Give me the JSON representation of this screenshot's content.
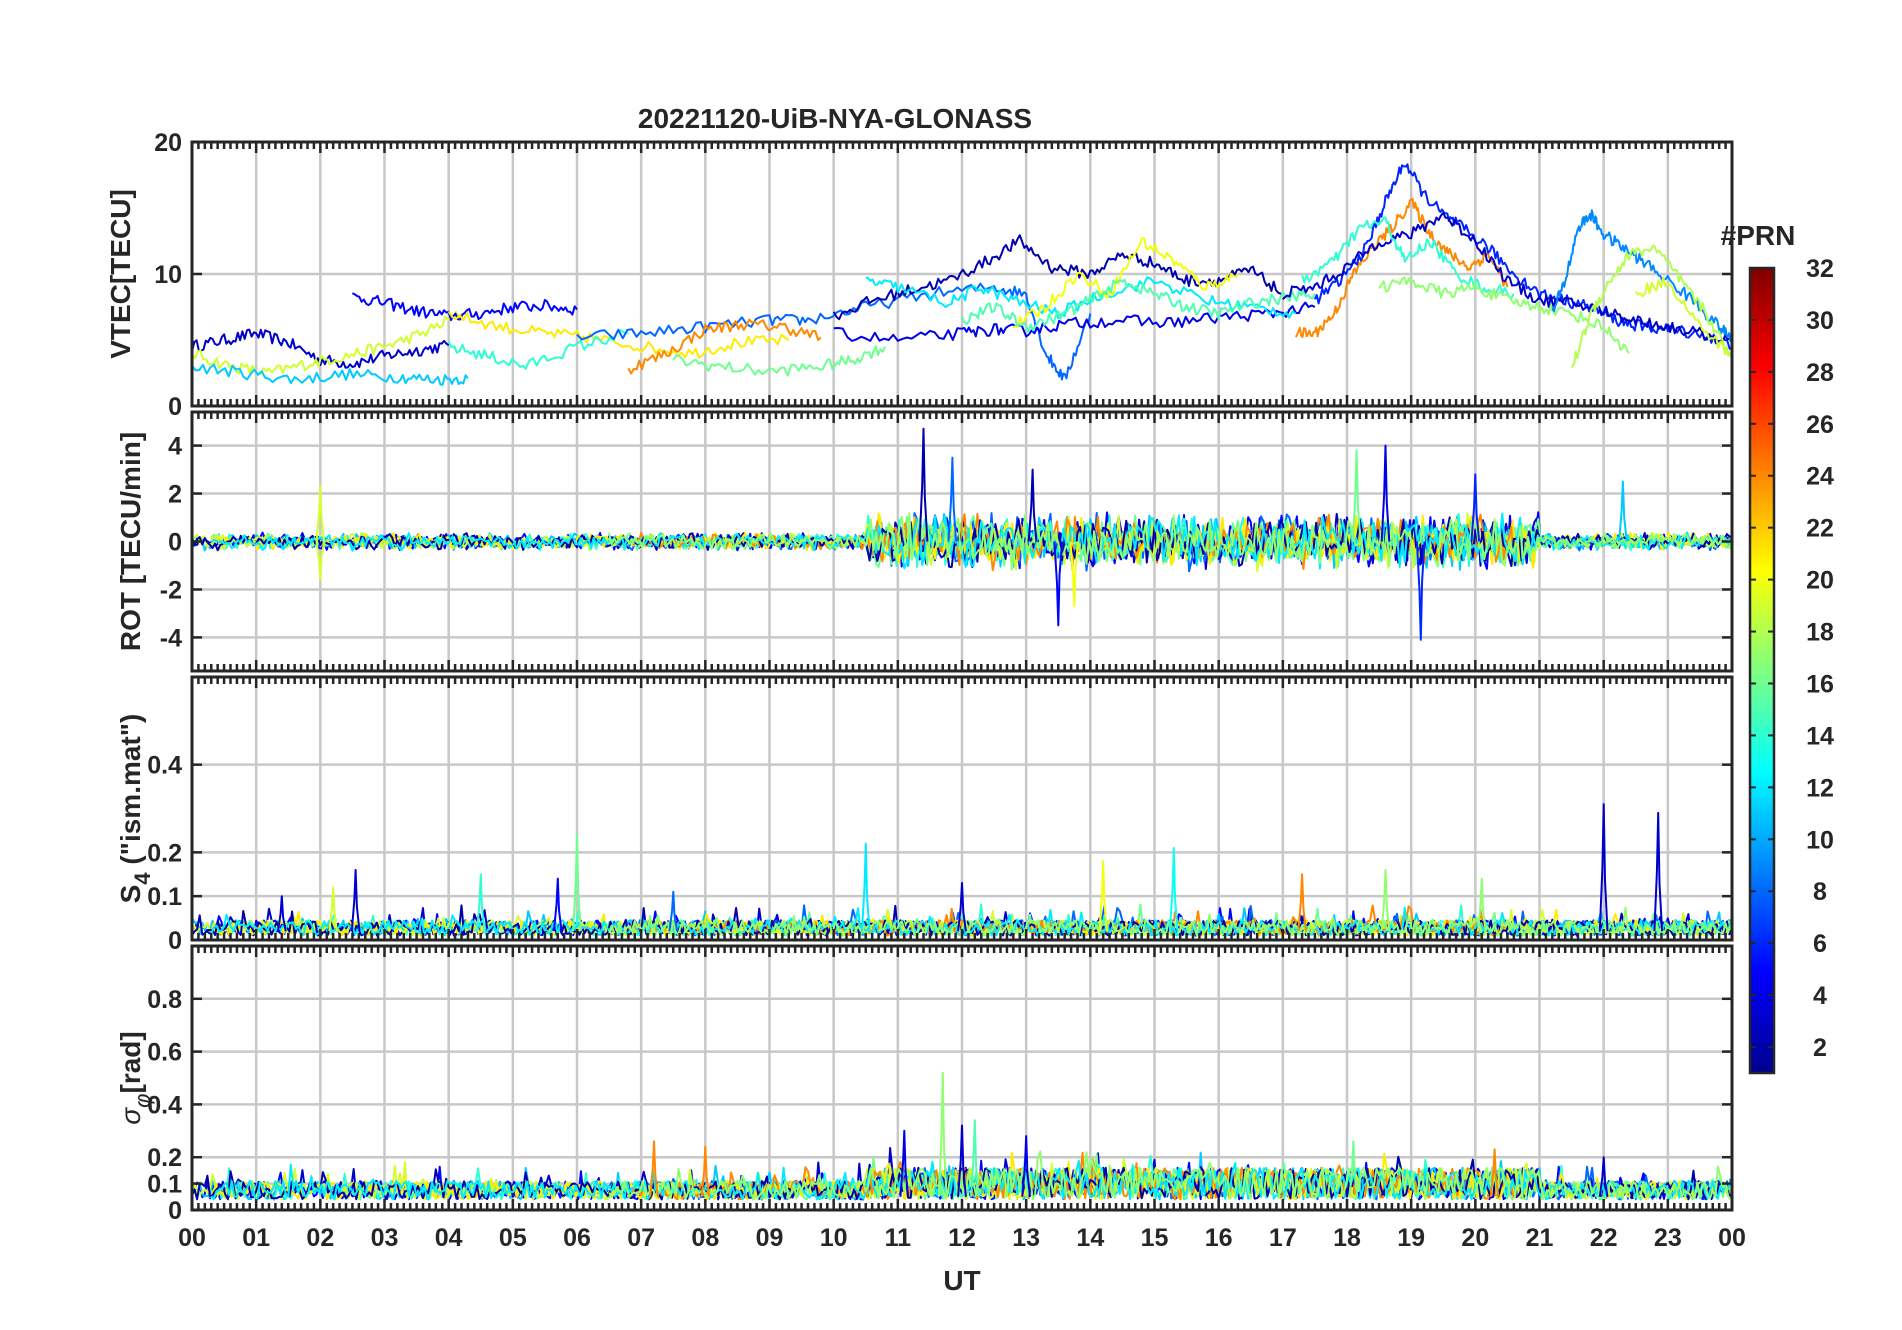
{
  "figure": {
    "title": "20221120-UiB-NYA-GLONASS"
  },
  "colorbar": {
    "label": "#PRN",
    "ticks": [
      "2",
      "4",
      "6",
      "8",
      "10",
      "12",
      "14",
      "16",
      "18",
      "20",
      "22",
      "24",
      "26",
      "28",
      "30",
      "32"
    ],
    "range": [
      1,
      32
    ],
    "colormap": "jet",
    "colors": [
      "#00008f",
      "#0000ff",
      "#0080ff",
      "#00ffff",
      "#80ff80",
      "#ffff00",
      "#ff8000",
      "#ff0000",
      "#800000"
    ]
  },
  "x_axis": {
    "label": "UT",
    "ticks": [
      "00",
      "01",
      "02",
      "03",
      "04",
      "05",
      "06",
      "07",
      "08",
      "09",
      "10",
      "11",
      "12",
      "13",
      "14",
      "15",
      "16",
      "17",
      "18",
      "19",
      "20",
      "21",
      "22",
      "23",
      "00"
    ],
    "range_hours": [
      0,
      24
    ]
  },
  "chart_data": [
    {
      "type": "line",
      "panel": "vtec",
      "ylabel": "VTEC[TECU]",
      "ylim": [
        0,
        20
      ],
      "yticks": [
        "0",
        "10",
        "20"
      ],
      "grid": true,
      "series": [
        {
          "prn": 3,
          "x": [
            0.0,
            0.5,
            1.0,
            1.5,
            2.0,
            2.5,
            3.0,
            3.5,
            4.0
          ],
          "y": [
            4.5,
            5.0,
            5.5,
            4.8,
            3.5,
            3.2,
            3.8,
            4.2,
            4.6
          ]
        },
        {
          "prn": 19,
          "x": [
            0.0,
            0.6,
            1.2,
            1.8,
            2.4,
            3.0,
            3.6,
            4.2
          ],
          "y": [
            4.0,
            3.0,
            2.5,
            3.2,
            3.8,
            4.5,
            5.5,
            7.0
          ]
        },
        {
          "prn": 11,
          "x": [
            0.0,
            0.8,
            1.6,
            2.4,
            3.2,
            3.8,
            4.3
          ],
          "y": [
            3.0,
            2.5,
            2.0,
            2.4,
            2.2,
            2.0,
            2.1
          ]
        },
        {
          "prn": 5,
          "x": [
            2.5,
            3.0,
            3.5,
            4.0,
            4.5,
            5.0,
            5.5,
            6.0
          ],
          "y": [
            8.3,
            7.8,
            7.2,
            6.8,
            7.0,
            7.5,
            7.6,
            7.3
          ]
        },
        {
          "prn": 21,
          "x": [
            4.0,
            4.8,
            5.5,
            6.2,
            7.0,
            7.8,
            8.5,
            9.3
          ],
          "y": [
            7.0,
            6.0,
            5.5,
            5.2,
            4.5,
            4.0,
            4.8,
            5.0
          ]
        },
        {
          "prn": 14,
          "x": [
            4.0,
            4.6,
            5.2,
            6.0,
            6.8
          ],
          "y": [
            4.5,
            3.8,
            3.0,
            4.5,
            5.5
          ]
        },
        {
          "prn": 8,
          "x": [
            6.0,
            7.0,
            8.0,
            9.0,
            9.6,
            10.5,
            11.5,
            12.5,
            13.0,
            13.3,
            13.6,
            14.0
          ],
          "y": [
            5.2,
            5.5,
            6.0,
            6.5,
            6.5,
            7.5,
            8.5,
            9.0,
            8.5,
            4.0,
            2.0,
            7.0
          ]
        },
        {
          "prn": 24,
          "x": [
            6.8,
            7.4,
            8.0,
            8.6,
            9.2,
            9.8
          ],
          "y": [
            2.8,
            4.0,
            5.8,
            6.2,
            6.0,
            5.2
          ]
        },
        {
          "prn": 16,
          "x": [
            7.5,
            8.2,
            9.0,
            9.8,
            10.3,
            10.8
          ],
          "y": [
            3.5,
            3.0,
            2.6,
            3.0,
            3.5,
            4.5
          ]
        },
        {
          "prn": 2,
          "x": [
            10.0,
            10.6,
            11.2,
            11.8,
            12.4,
            12.9,
            13.4,
            14.0,
            14.5,
            15.0,
            15.5,
            16.0,
            16.5,
            17.0
          ],
          "y": [
            6.8,
            8.0,
            8.8,
            9.5,
            11.0,
            12.5,
            10.5,
            10.0,
            11.5,
            10.8,
            9.5,
            9.5,
            10.3,
            8.5
          ]
        },
        {
          "prn": 4,
          "x": [
            10.0,
            11.0,
            12.0,
            12.5,
            13.0,
            13.6,
            14.4,
            15.2,
            16.0,
            16.8,
            17.5
          ],
          "y": [
            5.5,
            5.0,
            5.5,
            5.8,
            5.7,
            6.2,
            6.5,
            6.3,
            6.7,
            7.0,
            7.5
          ]
        },
        {
          "prn": 12,
          "x": [
            10.5,
            11.0,
            11.8,
            12.3,
            12.8,
            13.5,
            14.2,
            15.0,
            15.8,
            16.5,
            17.2
          ],
          "y": [
            9.5,
            9.0,
            7.8,
            9.0,
            8.0,
            7.0,
            8.5,
            9.5,
            8.0,
            7.5,
            7.0
          ]
        },
        {
          "prn": 20,
          "x": [
            12.8,
            13.3,
            13.8,
            14.3,
            14.8,
            15.3,
            15.8,
            16.3
          ],
          "y": [
            6.0,
            7.5,
            10.0,
            8.5,
            12.5,
            11.0,
            9.0,
            10.0
          ]
        },
        {
          "prn": 15,
          "x": [
            12.0,
            12.5,
            13.0,
            13.5,
            14.0,
            14.5,
            15.0,
            15.5,
            16.0,
            16.5,
            17.0,
            17.5
          ],
          "y": [
            6.5,
            7.5,
            6.0,
            6.8,
            8.0,
            9.5,
            8.5,
            7.5,
            7.0,
            7.8,
            8.2,
            8.5
          ]
        },
        {
          "prn": 24,
          "x": [
            17.2,
            17.5,
            17.8,
            18.1,
            18.4,
            18.7,
            19.0,
            19.3,
            19.6,
            19.9,
            20.2,
            20.5
          ],
          "y": [
            5.5,
            5.5,
            7.0,
            10.0,
            12.0,
            13.5,
            15.5,
            13.0,
            11.5,
            10.5,
            11.5,
            9.0
          ]
        },
        {
          "prn": 6,
          "x": [
            17.5,
            17.9,
            18.3,
            18.6,
            18.9,
            19.2,
            19.5,
            19.8,
            20.2,
            20.6,
            21.0,
            21.4,
            21.8,
            22.2,
            22.6,
            23.0,
            23.5,
            24.0
          ],
          "y": [
            8.0,
            9.5,
            12.0,
            15.5,
            18.5,
            16.0,
            14.5,
            13.5,
            12.0,
            10.0,
            8.5,
            8.0,
            7.5,
            6.5,
            6.0,
            5.8,
            5.5,
            4.5
          ]
        },
        {
          "prn": 3,
          "x": [
            17.0,
            17.5,
            18.0,
            18.5,
            19.0,
            19.5,
            20.0,
            20.5,
            21.0,
            21.5,
            22.0,
            22.5,
            23.0,
            23.5,
            24.0
          ],
          "y": [
            8.5,
            9.0,
            10.5,
            12.5,
            13.0,
            14.5,
            12.5,
            9.5,
            8.0,
            7.8,
            7.2,
            6.5,
            6.0,
            5.5,
            4.8
          ]
        },
        {
          "prn": 14,
          "x": [
            17.3,
            17.8,
            18.2,
            18.6,
            18.9,
            19.3,
            19.7,
            20.1,
            20.6
          ],
          "y": [
            9.5,
            11.0,
            13.5,
            14.0,
            11.0,
            12.5,
            10.0,
            9.0,
            8.5
          ]
        },
        {
          "prn": 17,
          "x": [
            18.5,
            19.0,
            19.5,
            20.0,
            20.5,
            21.0,
            21.5,
            22.0,
            22.4
          ],
          "y": [
            9.0,
            9.5,
            8.5,
            9.0,
            8.0,
            7.5,
            7.0,
            6.0,
            4.0
          ]
        },
        {
          "prn": 9,
          "x": [
            21.2,
            21.4,
            21.6,
            21.8,
            22.0,
            22.3,
            22.6,
            23.0,
            23.4,
            23.8,
            24.0
          ],
          "y": [
            7.0,
            9.5,
            13.5,
            14.5,
            13.0,
            12.0,
            11.0,
            9.5,
            8.0,
            6.0,
            5.0
          ]
        },
        {
          "prn": 18,
          "x": [
            21.5,
            21.8,
            22.1,
            22.4,
            22.8,
            23.2,
            23.6,
            24.0
          ],
          "y": [
            2.8,
            7.0,
            9.5,
            11.5,
            12.0,
            9.5,
            7.0,
            3.5
          ]
        },
        {
          "prn": 19,
          "x": [
            22.5,
            23.0,
            23.5,
            24.0
          ],
          "y": [
            8.5,
            9.5,
            6.0,
            3.8
          ]
        }
      ]
    },
    {
      "type": "line",
      "panel": "rot",
      "ylabel": "ROT [TECU/min]",
      "ylim": [
        -5.4,
        5.4
      ],
      "yticks": [
        "-4",
        "-2",
        "0",
        "2",
        "4"
      ],
      "grid": true,
      "spike_events": [
        {
          "prn": 2,
          "x": 11.4,
          "y": 4.7
        },
        {
          "prn": 8,
          "x": 11.85,
          "y": 3.5
        },
        {
          "prn": 2,
          "x": 13.1,
          "y": 3.0
        },
        {
          "prn": 5,
          "x": 13.5,
          "y": -3.5
        },
        {
          "prn": 20,
          "x": 13.75,
          "y": -2.7
        },
        {
          "prn": 4,
          "x": 18.6,
          "y": 4.0
        },
        {
          "prn": 6,
          "x": 19.15,
          "y": -4.1
        },
        {
          "prn": 11,
          "x": 22.3,
          "y": 2.5
        },
        {
          "prn": 19,
          "x": 2.0,
          "y": 2.3
        },
        {
          "prn": 19,
          "x": 2.0,
          "y": -1.6
        },
        {
          "prn": 16,
          "x": 18.15,
          "y": 3.8
        },
        {
          "prn": 6,
          "x": 20.0,
          "y": 2.8
        }
      ]
    },
    {
      "type": "line",
      "panel": "s4",
      "ylabel": "S_4 (\"ism.mat\")",
      "ylim": [
        0,
        0.6
      ],
      "yticks": [
        "0",
        "0.1",
        "0.2",
        "0.4"
      ],
      "grid": true,
      "spike_events": [
        {
          "prn": 3,
          "x": 1.4,
          "y": 0.1
        },
        {
          "prn": 19,
          "x": 2.2,
          "y": 0.12
        },
        {
          "prn": 3,
          "x": 2.55,
          "y": 0.16
        },
        {
          "prn": 14,
          "x": 4.5,
          "y": 0.15
        },
        {
          "prn": 5,
          "x": 5.7,
          "y": 0.14
        },
        {
          "prn": 16,
          "x": 6.0,
          "y": 0.24
        },
        {
          "prn": 8,
          "x": 7.5,
          "y": 0.11
        },
        {
          "prn": 12,
          "x": 10.5,
          "y": 0.22
        },
        {
          "prn": 3,
          "x": 12.0,
          "y": 0.13
        },
        {
          "prn": 20,
          "x": 14.2,
          "y": 0.18
        },
        {
          "prn": 13,
          "x": 15.3,
          "y": 0.21
        },
        {
          "prn": 24,
          "x": 17.3,
          "y": 0.15
        },
        {
          "prn": 17,
          "x": 18.6,
          "y": 0.16
        },
        {
          "prn": 17,
          "x": 20.1,
          "y": 0.14
        },
        {
          "prn": 3,
          "x": 22.0,
          "y": 0.31
        },
        {
          "prn": 3,
          "x": 22.85,
          "y": 0.29
        }
      ]
    },
    {
      "type": "line",
      "panel": "sigma_phi",
      "ylabel": "σ_φ[rad]",
      "ylim": [
        0,
        1.0
      ],
      "yticks": [
        "0",
        "0.1",
        "0.2",
        "0.4",
        "0.6",
        "0.8"
      ],
      "grid": true,
      "spike_events": [
        {
          "prn": 24,
          "x": 7.2,
          "y": 0.26
        },
        {
          "prn": 24,
          "x": 8.0,
          "y": 0.24
        },
        {
          "prn": 4,
          "x": 11.1,
          "y": 0.3
        },
        {
          "prn": 17,
          "x": 11.7,
          "y": 0.52
        },
        {
          "prn": 3,
          "x": 12.0,
          "y": 0.32
        },
        {
          "prn": 15,
          "x": 12.2,
          "y": 0.34
        },
        {
          "prn": 4,
          "x": 13.0,
          "y": 0.28
        },
        {
          "prn": 16,
          "x": 18.1,
          "y": 0.26
        },
        {
          "prn": 24,
          "x": 20.3,
          "y": 0.23
        },
        {
          "prn": 3,
          "x": 22.0,
          "y": 0.2
        }
      ]
    }
  ]
}
